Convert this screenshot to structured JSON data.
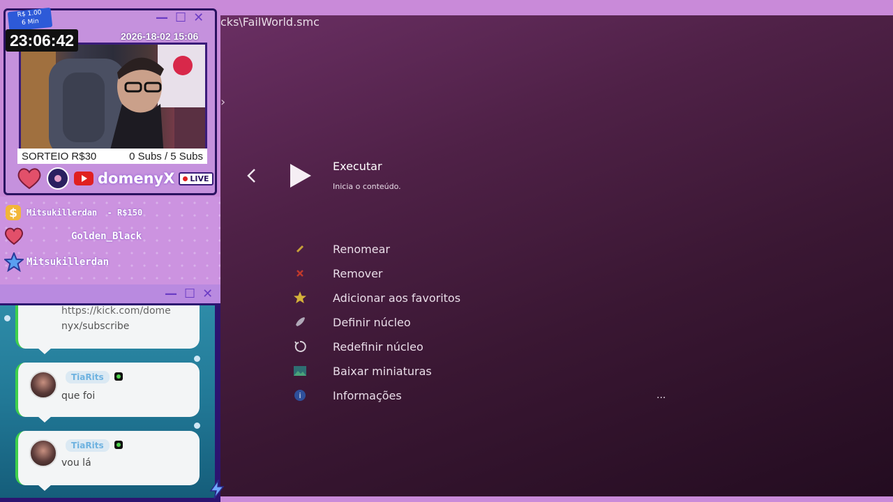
{
  "menu": {
    "path": "cks\\FailWorld.smc",
    "run": {
      "title": "Executar",
      "subtitle": "Inicia o conteúdo."
    },
    "items": [
      {
        "label": "Renomear",
        "icon": "pencil-icon",
        "color": "#c9a23a"
      },
      {
        "label": "Remover",
        "icon": "close-icon",
        "color": "#c0392b"
      },
      {
        "label": "Adicionar aos favoritos",
        "icon": "star-icon",
        "color": "#d4b13a"
      },
      {
        "label": "Definir núcleo",
        "icon": "rocket-icon",
        "color": "#b0a8b8"
      },
      {
        "label": "Redefinir núcleo",
        "icon": "reset-icon",
        "color": "#d8d0d8"
      },
      {
        "label": "Baixar miniaturas",
        "icon": "image-icon",
        "color": "#4aa37a"
      },
      {
        "label": "Informações",
        "icon": "info-icon",
        "color": "#3a6ab0"
      }
    ],
    "ellipsis": "..."
  },
  "overlay": {
    "donation": {
      "amount": "R$ 1.00",
      "duration": "6 Min"
    },
    "clock": "23:06:42",
    "date": "2026-18-02 15:06",
    "caption": {
      "left": "SORTEIO R$30",
      "right": "0 Subs / 5 Subs"
    },
    "channel": "domenyX",
    "live": "LIVE",
    "events": [
      {
        "icon": "dollar-icon",
        "text": "Mitsukillerdan  - R$150"
      },
      {
        "icon": "heart-icon",
        "text": "Golden_Black"
      },
      {
        "icon": "star-icon",
        "text": "Mitsukillerdan"
      }
    ],
    "chat": [
      {
        "user": "",
        "message": "https://kick.com/domenyx/subscribe",
        "line1": "https://kick.com/dome",
        "line2": "nyx/subscribe"
      },
      {
        "user": "TiaRits",
        "message": "que foi"
      },
      {
        "user": "TiaRits",
        "message": "vou lá"
      }
    ]
  },
  "colors": {
    "accent": "#c591dd",
    "frame": "#2a1260",
    "menu_bg": "#4f2147"
  }
}
